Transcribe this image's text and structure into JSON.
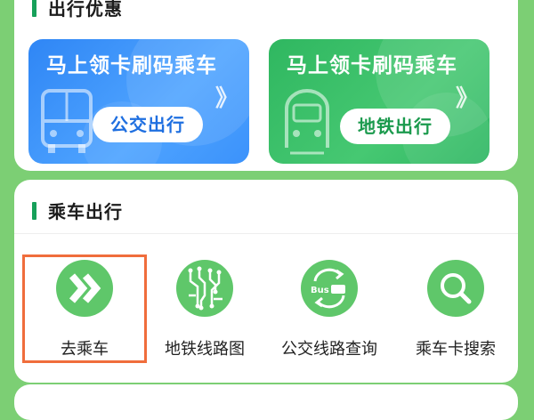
{
  "section_top": {
    "title": "出行优惠"
  },
  "banners": [
    {
      "title": "马上领卡刷码乘车",
      "button": "公交出行",
      "chevron": "》",
      "icon": "bus-icon",
      "color": "#3b8ff8"
    },
    {
      "title": "马上领卡刷码乘车",
      "button": "地铁出行",
      "chevron": "》",
      "icon": "metro-train-icon",
      "color": "#3cbf69"
    }
  ],
  "section_ride": {
    "title": "乘车出行"
  },
  "services": [
    {
      "label": "去乘车",
      "icon": "double-chevron-right-icon",
      "selected": true
    },
    {
      "label": "地铁线路图",
      "icon": "metro-map-icon",
      "selected": false
    },
    {
      "label": "公交线路查询",
      "icon": "bus-route-swap-icon",
      "selected": false,
      "icon_text_bus": "Bus"
    },
    {
      "label": "乘车卡搜索",
      "icon": "search-icon",
      "selected": false
    }
  ],
  "colors": {
    "background": "#7ccf74",
    "accent_green": "#17a05a",
    "icon_green": "#5fc76a",
    "highlight": "#f06d3c"
  }
}
